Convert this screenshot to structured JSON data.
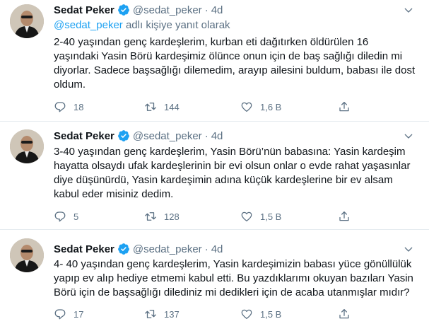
{
  "colors": {
    "accent": "#1da1f2",
    "secondary_text": "#5b7083",
    "divider": "#e6ecf0"
  },
  "icons": {
    "verified": "verified-badge-icon",
    "more": "more-chevron-icon",
    "reply": "reply-bubble-icon",
    "retweet": "retweet-arrows-icon",
    "like": "heart-icon",
    "share": "share-upload-icon"
  },
  "tweets": [
    {
      "name": "Sedat Peker",
      "handle": "@sedat_peker",
      "dot": "·",
      "time": "4d",
      "reply_mention": "@sedat_peker",
      "reply_suffix": " adlı kişiye yanıt olarak",
      "text": "2-40 yaşından genç kardeşlerim, kurban eti dağıtırken öldürülen 16\nyaşındaki Yasin Börü kardeşimiz ölünce onun için de baş sağlığı diledin mi\ndiyorlar. Sadece başsağlığı dilemedim, arayıp ailesini buldum, babası ile dost\noldum.",
      "replies": "18",
      "retweets": "144",
      "likes": "1,6 B"
    },
    {
      "name": "Sedat Peker",
      "handle": "@sedat_peker",
      "dot": "·",
      "time": "4d",
      "text": "3-40 yaşından genç kardeşlerim, Yasin Börü’nün babasına: Yasin kardeşim\nhayatta olsaydı ufak kardeşlerinin bir evi olsun onlar o evde rahat yaşasınlar\ndiye düşünürdü, Yasin kardeşimin adına küçük kardeşlerine bir ev alsam\nkabul eder misiniz dedim.",
      "replies": "5",
      "retweets": "128",
      "likes": "1,5 B"
    },
    {
      "name": "Sedat Peker",
      "handle": "@sedat_peker",
      "dot": "·",
      "time": "4d",
      "text": "4- 40 yaşından genç kardeşlerim, Yasin kardeşimizin babası yüce gönüllülük\nyapıp ev alıp hediye etmemi kabul etti. Bu yazdıklarımı okuyan bazıları Yasin\nBörü için de başsağlığı dilediniz mi dedikleri için de acaba utanmışlar mıdır?",
      "replies": "17",
      "retweets": "137",
      "likes": "1,5 B"
    }
  ]
}
